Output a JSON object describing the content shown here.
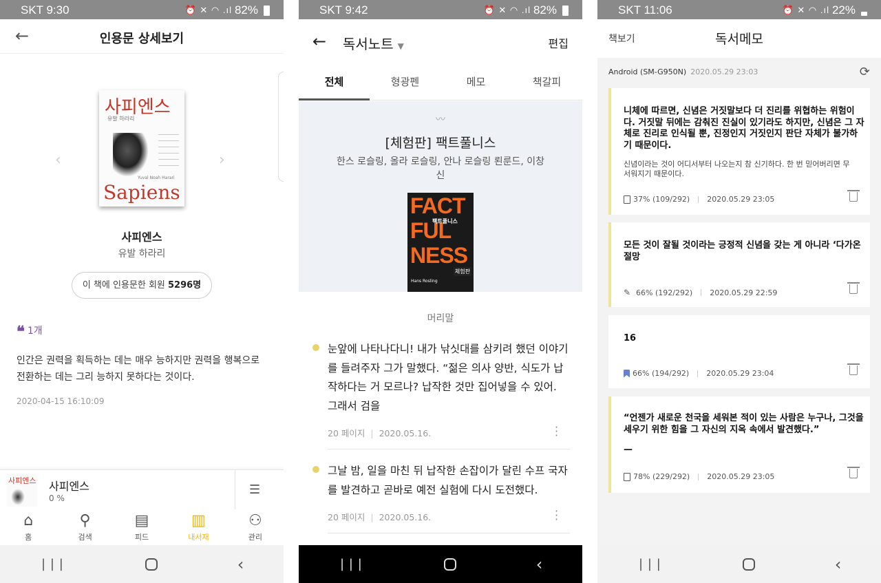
{
  "phone1": {
    "status": {
      "carrier": "SKT 9:30",
      "battery": "82%"
    },
    "header": {
      "title": "인용문 상세보기"
    },
    "cover": {
      "title_ko": "사피엔스",
      "author_ko": "유발 하라리",
      "title_en": "Sapiens",
      "author_en": "Yuval Noah Harari"
    },
    "book": {
      "title": "사피엔스",
      "author": "유발 하라리"
    },
    "quoters": {
      "prefix": "이 책에 인용문한 회원 ",
      "count": "5296명"
    },
    "quote": {
      "count": "1개",
      "text": "인간은 권력을 획득하는 데는 매우 능하지만 권력을 행복으로 전환하는 데는 그리 능하지 못하다는 것이다.",
      "date": "2020-04-15 16:10:09"
    },
    "mini": {
      "cover_text": "사피엔스",
      "title": "사피엔스",
      "progress": "0 %"
    },
    "tabs": [
      {
        "label": "홈",
        "icon": "⌂"
      },
      {
        "label": "검색",
        "icon": "⚲"
      },
      {
        "label": "피드",
        "icon": "▤"
      },
      {
        "label": "내서재",
        "icon": "▥"
      },
      {
        "label": "관리",
        "icon": "⚇"
      }
    ],
    "accent": "#f0b400"
  },
  "phone2": {
    "status": {
      "carrier": "SKT 9:42",
      "battery": "82%"
    },
    "header": {
      "title": "독서노트",
      "edit": "편집"
    },
    "tabs": [
      "전체",
      "형광펜",
      "메모",
      "책갈피"
    ],
    "book": {
      "title": "[체험판] 팩트풀니스",
      "authors": "한스 로슬링, 올라 로슬링, 안나 로슬링 뢴룬드, 이창신"
    },
    "cover": {
      "line1": "FACT",
      "line2": "FUL",
      "line3": "NESS",
      "kr": "팩트풀니스",
      "author": "Hans Rosling",
      "badge": "체험판"
    },
    "section": "머리말",
    "notes": [
      {
        "text": "눈앞에 나타나다니! 내가 낚싯대를 삼키려 했던 이야기를 들려주자 그가 말했다. “젊은 의사 양반, 식도가 납작하다는 거 모르나? 납작한 것만 집어넣을 수 있어. 그래서 검을",
        "page": "20 페이지",
        "date": "2020.05.16."
      },
      {
        "text": "그날 밤, 일을 마친 뒤 납작한 손잡이가 달린 수프 국자를 발견하고 곧바로 예전 실험에 다시 도전했다.",
        "page": "20 페이지",
        "date": "2020.05.16."
      }
    ],
    "highlight_color": "#e6d36a"
  },
  "phone3": {
    "status": {
      "carrier": "SKT 11:06",
      "battery": "22%"
    },
    "header": {
      "left": "책보기",
      "title": "독서메모"
    },
    "device": {
      "name": "Android (SM-G950N)",
      "date": "2020.05.29 23:03"
    },
    "memos": [
      {
        "text": "니체에 따르면, 신념은 거짓말보다 더 진리를 위협하는 위험이다. 거짓말 뒤에는 감춰진 진실이 있기라도 하지만, 신념은 그 자체로 진리로 인식될 뿐, 진정인지 거짓인지 판단 자체가 불가하기 때문이다.",
        "note": "신념이라는 것이 어디서부터 나오는지 참 신기하다. 한 번 믿어버리면 무서워지기 때문이다.",
        "progress": "37% (109/292)",
        "date": "2020.05.29 23:05",
        "icon": "page-icon"
      },
      {
        "text": "모든 것이 잘될 것이라는 긍정적 신념을 갖는 게 아니라 ‘다가온 절망",
        "progress": "66% (192/292)",
        "date": "2020.05.29 22:59",
        "icon": "pen-icon"
      },
      {
        "text": "16",
        "progress": "66% (194/292)",
        "date": "2020.05.29 23:04",
        "icon": "bookmark-icon"
      },
      {
        "text": "“언젠가 새로운 천국을 세워본 적이 있는 사람은 누구나, 그것을 세우기 위한 힘을 그 자신의 지옥 속에서 발견했다.”",
        "text2": "—",
        "progress": "78% (229/292)",
        "date": "2020.05.29 23:05",
        "icon": "page-icon"
      }
    ],
    "memo_accent": "#efe49a",
    "bookmark_color": "#6b7fd1"
  }
}
